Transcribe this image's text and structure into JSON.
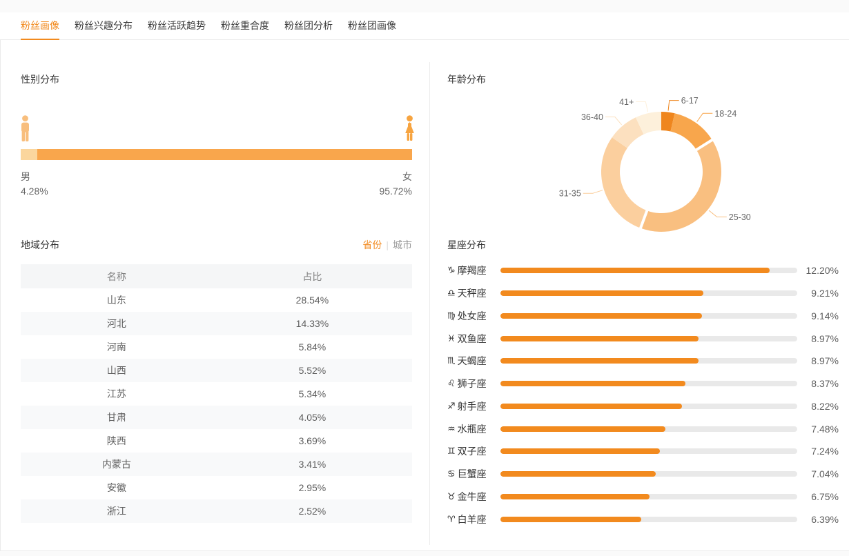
{
  "colors": {
    "accent": "#f28a1e",
    "track": "#e9e9e9",
    "male_bar": "#fbd69d",
    "female_bar": "#f9a64c",
    "male_icon": "#f8be7d",
    "female_icon": "#f7a440"
  },
  "tab_bar": {
    "tabs": [
      {
        "label": "粉丝画像",
        "active": true
      },
      {
        "label": "粉丝兴趣分布",
        "active": false
      },
      {
        "label": "粉丝活跃趋势",
        "active": false
      },
      {
        "label": "粉丝重合度",
        "active": false
      },
      {
        "label": "粉丝团分析",
        "active": false
      },
      {
        "label": "粉丝团画像",
        "active": false
      }
    ]
  },
  "gender": {
    "title": "性别分布",
    "male_label": "男",
    "male_value": "4.28%",
    "male_pct": 4.28,
    "female_label": "女",
    "female_value": "95.72%",
    "female_pct": 95.72
  },
  "region": {
    "title": "地域分布",
    "toggle": {
      "province": "省份",
      "divider": "|",
      "city": "城市",
      "active": "省份"
    },
    "table": {
      "headers": [
        "名称",
        "占比"
      ],
      "rows": [
        [
          "山东",
          "28.54%"
        ],
        [
          "河北",
          "14.33%"
        ],
        [
          "河南",
          "5.84%"
        ],
        [
          "山西",
          "5.52%"
        ],
        [
          "江苏",
          "5.34%"
        ],
        [
          "甘肃",
          "4.05%"
        ],
        [
          "陕西",
          "3.69%"
        ],
        [
          "内蒙古",
          "3.41%"
        ],
        [
          "安徽",
          "2.95%"
        ],
        [
          "浙江",
          "2.52%"
        ]
      ]
    }
  },
  "age": {
    "title": "年龄分布"
  },
  "zodiac": {
    "title": "星座分布"
  },
  "chart_data": [
    {
      "type": "pie",
      "title": "年龄分布",
      "donut": true,
      "labels": [
        "6-17",
        "18-24",
        "25-30",
        "31-35",
        "36-40",
        "41+"
      ],
      "values": [
        3.6,
        12.5,
        39.5,
        29.1,
        8.3,
        7.0
      ],
      "values_estimated_from_arc_angles": true,
      "colors": [
        "#ef861e",
        "#f8a64c",
        "#f9bf80",
        "#fbcf9e",
        "#fce0bf",
        "#fdf0db"
      ],
      "legend_position": "none"
    },
    {
      "type": "bar",
      "title": "星座分布",
      "orientation": "horizontal",
      "categories": [
        "摩羯座",
        "天秤座",
        "处女座",
        "双鱼座",
        "天蝎座",
        "狮子座",
        "射手座",
        "水瓶座",
        "双子座",
        "巨蟹座",
        "金牛座",
        "白羊座"
      ],
      "icons": [
        "♑",
        "♎",
        "♍",
        "♓",
        "♏",
        "♌",
        "♐",
        "♒",
        "♊",
        "♋",
        "♉",
        "♈"
      ],
      "values": [
        12.2,
        9.21,
        9.14,
        8.97,
        8.97,
        8.37,
        8.22,
        7.48,
        7.24,
        7.04,
        6.75,
        6.39
      ],
      "value_labels": [
        "12.20%",
        "9.21%",
        "9.14%",
        "8.97%",
        "8.97%",
        "8.37%",
        "8.22%",
        "7.48%",
        "7.24%",
        "7.04%",
        "6.75%",
        "6.39%"
      ],
      "xlim": [
        0,
        13.45
      ],
      "grid": false
    },
    {
      "type": "bar",
      "title": "性别分布",
      "orientation": "horizontal",
      "stacked": true,
      "categories": [
        "男",
        "女"
      ],
      "values": [
        4.28,
        95.72
      ]
    }
  ]
}
